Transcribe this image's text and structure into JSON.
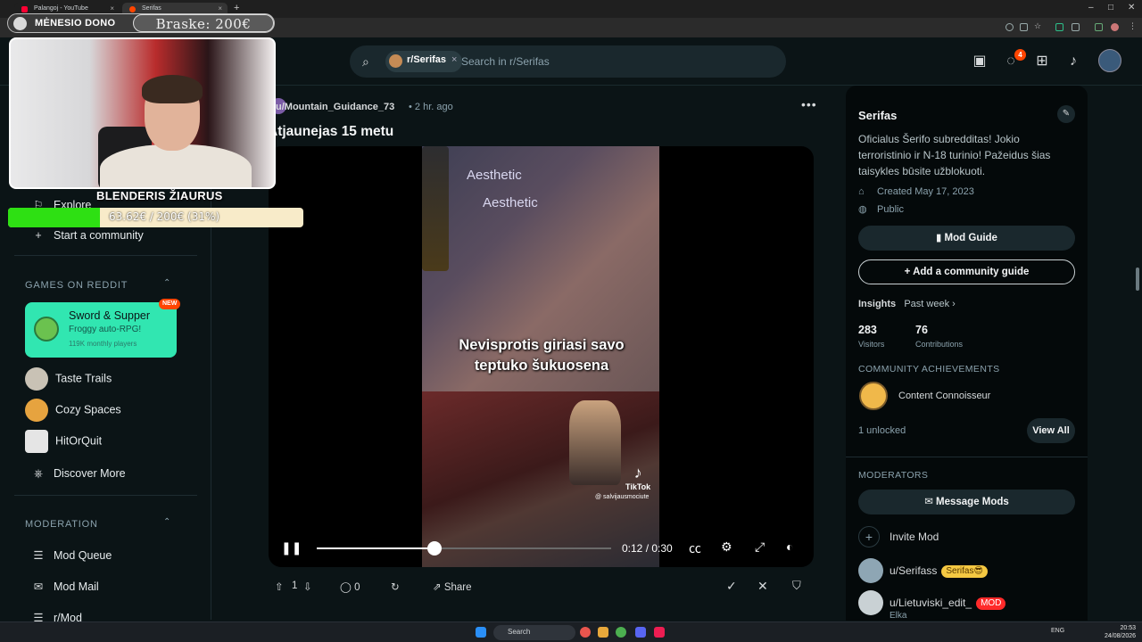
{
  "browser": {
    "tabs": [
      {
        "label": "Palangoj - YouTube",
        "close": "×"
      },
      {
        "label": "Serifas",
        "close": "×"
      }
    ],
    "new_tab": "+",
    "window_controls": [
      "–",
      "□",
      "✕"
    ]
  },
  "header": {
    "search_chip": "r/Serifas",
    "search_chip_close": "×",
    "search_placeholder": "Search in r/Serifas",
    "notification_count": "4",
    "icons": [
      "advertise-icon",
      "chat-icon",
      "create-post-icon",
      "notifications-icon",
      "user-avatar"
    ]
  },
  "sidebar": {
    "explore": "Explore",
    "start_community": "Start a community",
    "games_heading": "GAMES ON REDDIT",
    "featured_game": {
      "title": "Sword & Supper",
      "subtitle": "Froggy auto-RPG!",
      "players": "119K monthly players",
      "badge": "NEW"
    },
    "games": [
      {
        "label": "Taste Trails",
        "color": "#c9c2b5"
      },
      {
        "label": "Cozy Spaces",
        "color": "#e6a33f"
      },
      {
        "label": "HitOrQuit",
        "color": "#e5e5e5"
      },
      {
        "label": "Discover More",
        "color": ""
      }
    ],
    "moderation_heading": "MODERATION",
    "moderation_items": [
      "Mod Queue",
      "Mod Mail",
      "r/Mod"
    ]
  },
  "post": {
    "author": "u/Mountain_Guidance_73",
    "time": "• 2 hr. ago",
    "more": "•••",
    "title": "Atjaunejas 15 metu",
    "video": {
      "watermark_1": "Aesthetic",
      "watermark_2": "Aesthetic",
      "caption_line1": "Nevisprotis giriasi savo",
      "caption_line2": "teptuko šukuosena",
      "tiktok_label": "TikTok",
      "tiktok_handle": "@ salvijausmociute",
      "time_display": "0:12 / 0:30",
      "progress": 0.4
    },
    "actions": {
      "votes": "1",
      "comments": "0",
      "share": "Share"
    }
  },
  "right_sidebar": {
    "community_name": "Serifas",
    "description": "Oficialus Šerifo subredditas! Jokio terroristinio ir N-18 turinio! Pažeidus šias taisykles būsite užblokuoti.",
    "created": "Created May 17, 2023",
    "visibility": "Public",
    "mod_guide_button": "Mod Guide",
    "add_guide_button": "Add a community guide",
    "insights_label": "Insights",
    "insights_period": "Past week ›",
    "stats": [
      {
        "value": "283",
        "label": "Visitors"
      },
      {
        "value": "76",
        "label": "Contributions"
      }
    ],
    "achievements_heading": "COMMUNITY ACHIEVEMENTS",
    "achievement_name": "Content Connoisseur",
    "unlocked": "1 unlocked",
    "view_all": "View All",
    "moderators_heading": "MODERATORS",
    "message_mods": "Message Mods",
    "invite_mod": "Invite Mod",
    "moderators": [
      {
        "name": "u/Serifass",
        "flair": "Serifas😎",
        "flair_color": "#f5c842",
        "sub": ""
      },
      {
        "name": "u/Lietuviski_edit_",
        "flair": "MOD",
        "flair_color": "#ff2a2a",
        "sub": "Elka"
      }
    ]
  },
  "overlay": {
    "donation_label": "MĖNESIO DONO",
    "donation_amount": "Braske: 200€",
    "streamer_name": "BLENDERIS ŽIAURUS",
    "goal_text": "63.62€ / 200€ (31%)",
    "goal_fraction": 0.31
  },
  "taskbar": {
    "search": "Search",
    "lang": "ENG",
    "time": "20:53",
    "date": "24/08/2026"
  },
  "colors": {
    "accent": "#ff4500",
    "featured_game": "#31e6b1",
    "goal_fill": "#2ee013"
  }
}
